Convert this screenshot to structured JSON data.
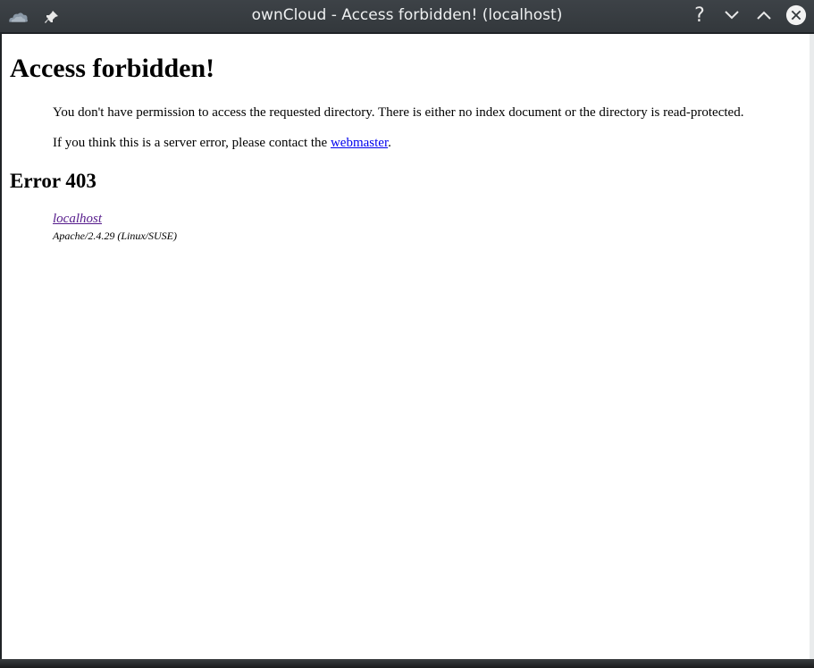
{
  "window": {
    "title": "ownCloud - Access forbidden! (localhost)",
    "icons": {
      "app": "owncloud-cloud-icon",
      "pin": "pin-icon",
      "help": "help-icon",
      "minimize": "chevron-down-icon",
      "maximize": "chevron-up-icon",
      "close": "close-icon"
    },
    "help_glyph": "?"
  },
  "page": {
    "heading": "Access forbidden!",
    "paragraph1": "You don't have permission to access the requested directory. There is either no index document or the directory is read-protected.",
    "paragraph2_prefix": "If you think this is a server error, please contact the ",
    "paragraph2_link": "webmaster",
    "paragraph2_suffix": ".",
    "error_heading": "Error 403",
    "address_link": "localhost",
    "server_signature": "Apache/2.4.29 (Linux/SUSE)"
  },
  "colors": {
    "titlebar": "#373c40",
    "link": "#0000ee",
    "visited_link": "#551a8b"
  }
}
